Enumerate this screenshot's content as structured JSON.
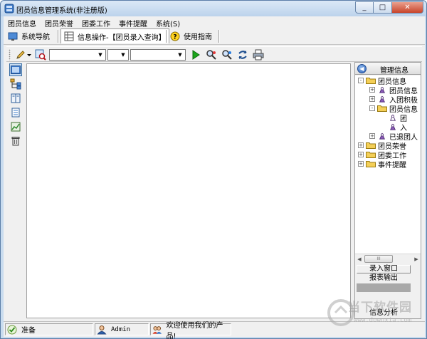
{
  "window": {
    "title": "团员信息管理系统(非注册版)",
    "buttons": {
      "minimize": "_",
      "maximize": "□",
      "close": "✕"
    }
  },
  "menubar": {
    "items": [
      "团员信息",
      "团员荣誉",
      "团委工作",
      "事件提醒",
      "系统(S)"
    ]
  },
  "navbar": {
    "system_nav": "系统导航",
    "info_operation": "信息操作-【团员录入查询】",
    "help": "使用指南"
  },
  "toolbar": {
    "combo1": "",
    "combo2": "",
    "combo3": ""
  },
  "right_panel": {
    "header": "管理信息",
    "tree": [
      {
        "label": "团员信息",
        "level": 0,
        "toggle": "-",
        "icon": "folder"
      },
      {
        "label": "团员信息",
        "level": 1,
        "toggle": "+",
        "icon": "person"
      },
      {
        "label": "入团积极",
        "level": 1,
        "toggle": "+",
        "icon": "person"
      },
      {
        "label": "团员信息",
        "level": 1,
        "toggle": "-",
        "icon": "folder"
      },
      {
        "label": "团",
        "level": 2,
        "toggle": "",
        "icon": "person"
      },
      {
        "label": "入",
        "level": 2,
        "toggle": "",
        "icon": "person"
      },
      {
        "label": "已退团人",
        "level": 1,
        "toggle": "+",
        "icon": "person"
      },
      {
        "label": "团员荣誉",
        "level": 0,
        "toggle": "+",
        "icon": "folder"
      },
      {
        "label": "团委工作",
        "level": 0,
        "toggle": "+",
        "icon": "folder"
      },
      {
        "label": "事件提醒",
        "level": 0,
        "toggle": "+",
        "icon": "folder"
      }
    ],
    "scroll_thumb": "III",
    "buttons": {
      "entry_window": "录入窗口",
      "report_output": "报表输出",
      "info_analysis": "信息分析"
    }
  },
  "statusbar": {
    "status": "准备",
    "user": "Admin",
    "welcome": "欢迎使用我们的产品!"
  },
  "watermark": {
    "text": "当下软件园",
    "url": "www.downxia.com"
  },
  "colors": {
    "accent": "#3a6ea5",
    "title_bar": "#c9dcef",
    "selected_item": "#a8a8a8"
  }
}
